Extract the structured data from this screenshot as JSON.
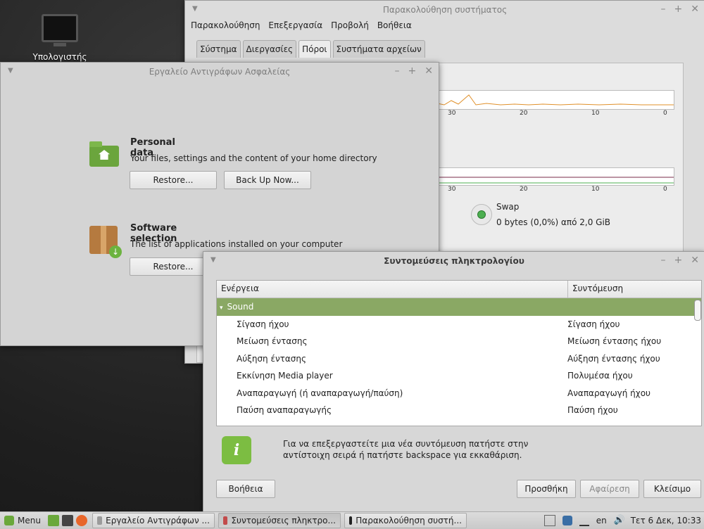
{
  "desktop": {
    "computer_label": "Υπολογιστής"
  },
  "system_monitor": {
    "title": "Παρακολούθηση συστήματος",
    "menu": [
      "Παρακολούθηση",
      "Επεξεργασία",
      "Προβολή",
      "Βοήθεια"
    ],
    "tabs": [
      "Σύστημα",
      "Διεργασίες",
      "Πόροι",
      "Συστήματα αρχείων"
    ],
    "selected_tab": "Πόροι",
    "axis_ticks": [
      "30",
      "20",
      "10",
      "0"
    ],
    "swap_label": "Swap",
    "swap_value": "0 bytes (0,0%) από 2,0 GiB",
    "colors": {
      "cpu_line": "#e0902a",
      "mem_line": "#7a2a4a",
      "swap_line": "#4caf50"
    }
  },
  "backup_tool": {
    "title": "Εργαλείο Αντιγράφων Ασφαλείας",
    "personal": {
      "title": "Personal data",
      "description": "Your files, settings and the content of your home directory",
      "restore_label": "Restore...",
      "backup_label": "Back Up Now..."
    },
    "software": {
      "title": "Software selection",
      "description": "The list of applications installed on your computer",
      "restore_label": "Restore..."
    }
  },
  "shortcuts": {
    "title": "Συντομεύσεις πληκτρολογίου",
    "col_action": "Ενέργεια",
    "col_shortcut": "Συντόμευση",
    "category": "Sound",
    "rows": [
      {
        "action": "Σίγαση ήχου",
        "shortcut": "Σίγαση ήχου"
      },
      {
        "action": "Μείωση έντασης",
        "shortcut": "Μείωση έντασης ήχου"
      },
      {
        "action": "Αύξηση έντασης",
        "shortcut": "Αύξηση έντασης ήχου"
      },
      {
        "action": "Εκκίνηση Media player",
        "shortcut": "Πολυμέσα ήχου"
      },
      {
        "action": "Αναπαραγωγή (ή αναπαραγωγή/παύση)",
        "shortcut": "Αναπαραγωγή ήχου"
      },
      {
        "action": "Παύση αναπαραγωγής",
        "shortcut": "Παύση ήχου"
      }
    ],
    "info_text": "Για να επεξεργαστείτε μια νέα συντόμευση πατήστε στην αντίστοιχη σειρά ή πατήστε backspace για εκκαθάριση.",
    "help_label": "Βοήθεια",
    "add_label": "Προσθήκη",
    "remove_label": "Αφαίρεση",
    "close_label": "Κλείσιμο",
    "accent": "#8aa864"
  },
  "taskbar": {
    "menu_label": "Menu",
    "windows": [
      {
        "label": "Εργαλείο Αντιγράφων ...",
        "active": false
      },
      {
        "label": "Συντομεύσεις πληκτρο...",
        "active": true
      },
      {
        "label": "Παρακολούθηση συστή...",
        "active": false
      }
    ],
    "keyboard_layout": "en",
    "clock": "Τετ  6 Δεκ, 10:33"
  }
}
